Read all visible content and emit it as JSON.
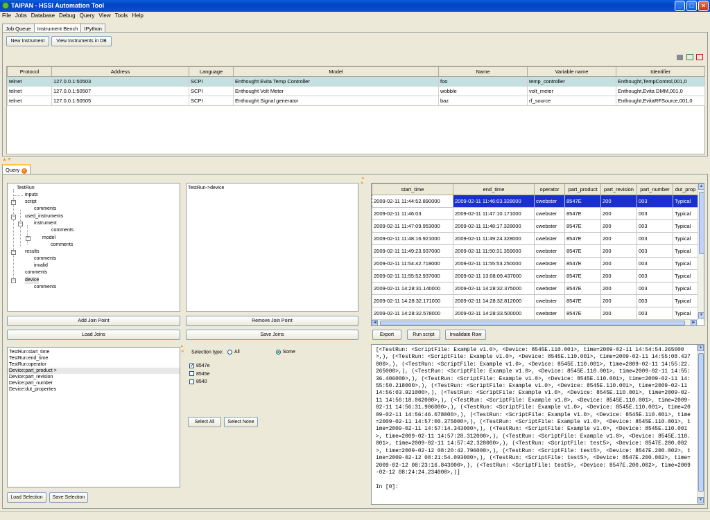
{
  "window": {
    "title": "TAIPAN - HSSI Automation Tool",
    "min": "_",
    "max": "□",
    "close": "×"
  },
  "menu": [
    "File",
    "Jobs",
    "Database",
    "Debug",
    "Query",
    "View",
    "Tools",
    "Help"
  ],
  "top_tabs": [
    "Job Queue",
    "Instrument Bench",
    "IPython"
  ],
  "bench": {
    "new_btn": "New Instrument",
    "view_btn": "View Instruments in DB",
    "columns": [
      "Protocol",
      "Address",
      "Language",
      "Model",
      "Name",
      "Variable name",
      "Identifier"
    ],
    "rows": [
      [
        "telnet",
        "127.0.0.1:50503",
        "SCPI",
        "Enthought Evita Temp Controller",
        "foo",
        "temp_controller",
        "Enthought,TempControl,001,0"
      ],
      [
        "telnet",
        "127.0.0.1:50507",
        "SCPI",
        "Enthought Volt Meter",
        "wobble",
        "volt_meter",
        "Enthought,Evita DMM,001,0"
      ],
      [
        "telnet",
        "127.0.0.1:50505",
        "SCPI",
        "Enthought Signal generator",
        "baz",
        "rf_source",
        "Enthought,EvitaRFSource,001,0"
      ]
    ]
  },
  "query_tab": "Query",
  "tree": [
    "TestRun",
    "inputs",
    "script",
    "comments",
    "used_instruments",
    "instrument",
    "comments",
    "model",
    "comments",
    "results",
    "comments",
    "invalid",
    "comments",
    "device",
    "comments"
  ],
  "join_text": "TestRun->device",
  "buttons": {
    "add_join": "Add Join Point",
    "remove_join": "Remove Join Point",
    "load_joins": "Load Joins",
    "save_joins": "Save Joins",
    "load_sel": "Load Selection",
    "save_sel": "Save Selection",
    "select_all": "Select All",
    "select_none": "Select None",
    "export": "Export",
    "run_script": "Run script",
    "invalidate": "Invalidate Row"
  },
  "fields": [
    "TestRun:start_time",
    "TestRun:end_time",
    "TestRun:operator",
    "Device:part_product >",
    "Device:part_revision",
    "Device:part_number",
    "Device:dut_properties"
  ],
  "selection": {
    "label": "Selection type:",
    "all": "All",
    "some": "Some",
    "options": [
      {
        "label": "8547e",
        "checked": true
      },
      {
        "label": "8545e",
        "checked": false
      },
      {
        "label": "8540",
        "checked": false
      }
    ]
  },
  "results": {
    "columns": [
      "start_time",
      "end_time",
      "operator",
      "part_product",
      "part_revision",
      "part_number",
      "dut_prop"
    ],
    "rows": [
      [
        "2009-02-11 11:44:52.890000",
        "2009-02-11 11:46:03.328000",
        "cwebster",
        "8547E",
        "200",
        "003",
        "Typical"
      ],
      [
        "2009-02-11 11:46:03",
        "2009-02-11 11:47:10.171000",
        "cwebster",
        "8547E",
        "200",
        "003",
        "Typical"
      ],
      [
        "2009-02-11 11:47:09.953000",
        "2009-02-11 11:48:17.328000",
        "cwebster",
        "8547E",
        "200",
        "003",
        "Typical"
      ],
      [
        "2009-02-11 11:48:16.921000",
        "2009-02-11 11:49:24.328000",
        "cwebster",
        "8547E",
        "200",
        "003",
        "Typical"
      ],
      [
        "2009-02-11 11:49:23.937000",
        "2009-02-11 11:50:31.359000",
        "cwebster",
        "8547E",
        "200",
        "003",
        "Typical"
      ],
      [
        "2009-02-11 11:54:42.718000",
        "2009-02-11 11:55:53.250000",
        "cwebster",
        "8547E",
        "200",
        "003",
        "Typical"
      ],
      [
        "2009-02-11 11:55:52.937000",
        "2009-02-11 13:08:09.437000",
        "cwebster",
        "8547E",
        "200",
        "003",
        "Typical"
      ],
      [
        "2009-02-11 14:28:31.140000",
        "2009-02-11 14:28:32.375000",
        "cwebster",
        "8547E",
        "200",
        "003",
        "Typical"
      ],
      [
        "2009-02-11 14:28:32.171000",
        "2009-02-11 14:28:32.812000",
        "cwebster",
        "8547E",
        "200",
        "003",
        "Typical"
      ],
      [
        "2009-02-11 14:28:32.578000",
        "2009-02-11 14:28:33.500000",
        "cwebster",
        "8547E",
        "200",
        "003",
        "Typical"
      ]
    ]
  },
  "ipython_output": "[<TestRun: <ScriptFile: Example v1.0>, <Device: 8545E.110.001>, time=2009-02-11 14:54:54.265000>,), (<TestRun: <ScriptFile: Example v1.0>, <Device: 8545E.110.001>, time=2009-02-11 14:55:08.437000>,), (<TestRun: <ScriptFile: Example v1.0>, <Device: 8545E.110.001>, time=2009-02-11 14:55:22.265000>,), (<TestRun: <ScriptFile: Example v1.0>, <Device: 8545E.110.001>, time=2009-02-11 14:55:36.406000>,), (<TestRun: <ScriptFile: Example v1.0>, <Device: 8545E.110.001>, time=2009-02-11 14:55:50.218000>,), (<TestRun: <ScriptFile: Example v1.0>, <Device: 8545E.110.001>, time=2009-02-11 14:56:03.921000>,), (<TestRun: <ScriptFile: Example v1.0>, <Device: 8545E.110.001>, time=2009-02-11 14:56:18.062000>,), (<TestRun: <ScriptFile: Example v1.0>, <Device: 8545E.110.001>, time=2009-02-11 14:56:31.906000>,), (<TestRun: <ScriptFile: Example v1.0>, <Device: 8545E.110.001>, time=2009-02-11 14:56:46.078000>,), (<TestRun: <ScriptFile: Example v1.0>, <Device: 8545E.110.001>, time=2009-02-11 14:57:00.375000>,), (<TestRun: <ScriptFile: Example v1.0>, <Device: 8545E.110.001>, time=2009-02-11 14:57:14.343000>,), (<TestRun: <ScriptFile: Example v1.0>, <Device: 8545E.110.001>, time=2009-02-11 14:57:28.312000>,), (<TestRun: <ScriptFile: Example v1.0>, <Device: 8545E.110.001>, time=2009-02-11 14:57:42.328000>,), (<TestRun: <ScriptFile: test5>, <Device: 8547E.200.002>, time=2009-02-12 08:20:42.796000>,), (<TestRun: <ScriptFile: test5>, <Device: 8547E.200.002>, time=2009-02-12 08:21:54.093000>,), (<TestRun: <ScriptFile: test5>, <Device: 8547E.200.002>, time=2009-02-12 08:23:16.843000>,), (<TestRun: <ScriptFile: test5>, <Device: 8547E.200.002>, time=2009-02-12 08:24:24.234000>,)]\n\nIn [0]:"
}
